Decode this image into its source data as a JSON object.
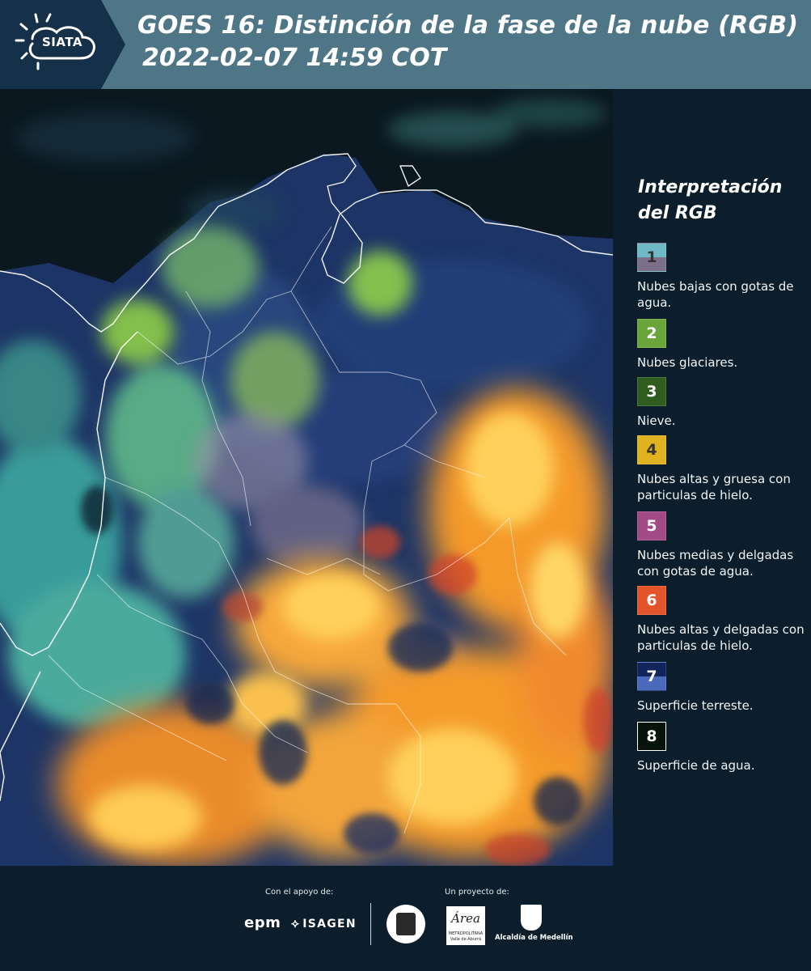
{
  "header": {
    "logo_text": "SIATA",
    "title_line1": "GOES 16: Distinción de la fase de la nube (RGB)",
    "title_line2": "2022-02-07 14:59 COT"
  },
  "legend": {
    "title": "Interpretación del RGB",
    "items": [
      {
        "num": "1",
        "label": "Nubes bajas con gotas de agua.",
        "color_top": "#6fb8c5",
        "color_bottom": "#7b6f89",
        "num_color": "#333333"
      },
      {
        "num": "2",
        "label": "Nubes glaciares.",
        "color_top": "#6aa53a",
        "color_bottom": "#6aa53a",
        "num_color": "#ffffff"
      },
      {
        "num": "3",
        "label": "Nieve.",
        "color_top": "#2e5d1f",
        "color_bottom": "#2e5d1f",
        "num_color": "#ffffff"
      },
      {
        "num": "4",
        "label": "Nubes altas y gruesa con particulas de hielo.",
        "color_top": "#e0b21f",
        "color_bottom": "#e0b21f",
        "num_color": "#333333"
      },
      {
        "num": "5",
        "label": "Nubes medias y delgadas con gotas de agua.",
        "color_top": "#a14a86",
        "color_bottom": "#a14a86",
        "num_color": "#ffffff"
      },
      {
        "num": "6",
        "label": "Nubes altas y delgadas con particulas de hielo.",
        "color_top": "#e4542a",
        "color_bottom": "#e4542a",
        "num_color": "#ffffff"
      },
      {
        "num": "7",
        "label": "Superficie terreste.",
        "color_top": "#13245c",
        "color_bottom": "#4a6bbd",
        "num_color": "#ffffff"
      },
      {
        "num": "8",
        "label": "Superficie de agua.",
        "color_top": "#07140c",
        "color_bottom": "#07140c",
        "num_color": "#ffffff"
      }
    ]
  },
  "footer": {
    "support_label": "Con el apoyo de:",
    "project_label": "Un proyecto de:",
    "epm_logo": "epm",
    "isagen_logo": "ISAGEN",
    "area_logo": "Área",
    "area_logo_small": "METROPOLITANA Valle de Aburrá",
    "alcaldia_logo": "Alcaldía de Medellín"
  },
  "colors": {
    "header_bg": "#4f7686",
    "panel_bg": "#0c1e2b",
    "ocean": "#0b1820",
    "land_blue": "#1d3566",
    "cloud_cyan": "#3ea8a0",
    "cloud_green": "#8fcf4a",
    "cloud_orange": "#f49a2c",
    "cloud_yellow": "#ffd15a",
    "cloud_red": "#d2452a"
  }
}
